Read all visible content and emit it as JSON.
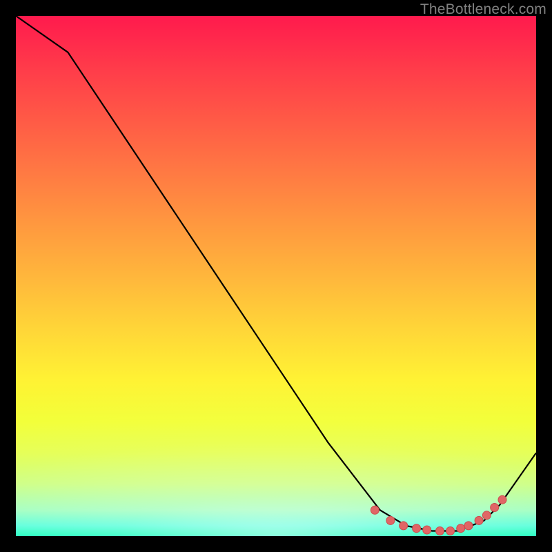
{
  "watermark": "TheBottleneck.com",
  "chart_data": {
    "type": "line",
    "title": "",
    "xlabel": "",
    "ylabel": "",
    "xlim": [
      0,
      100
    ],
    "ylim": [
      0,
      100
    ],
    "series": [
      {
        "name": "curve",
        "x": [
          0,
          10,
          20,
          30,
          40,
          50,
          60,
          70,
          75,
          80,
          85,
          90,
          93,
          100
        ],
        "y": [
          100,
          93,
          78,
          63,
          48,
          33,
          18,
          5,
          2,
          1,
          1,
          3,
          6,
          16
        ]
      }
    ],
    "markers": {
      "name": "dots",
      "x": [
        69,
        72,
        74.5,
        77,
        79,
        81.5,
        83.5,
        85.5,
        87,
        89,
        90.5,
        92,
        93.5
      ],
      "y": [
        5,
        3,
        2,
        1.5,
        1.2,
        1,
        1,
        1.5,
        2,
        3,
        4,
        5.5,
        7
      ]
    },
    "colors": {
      "curve": "#000000",
      "marker_fill": "#e06666",
      "marker_stroke": "#cc4b4b"
    }
  }
}
